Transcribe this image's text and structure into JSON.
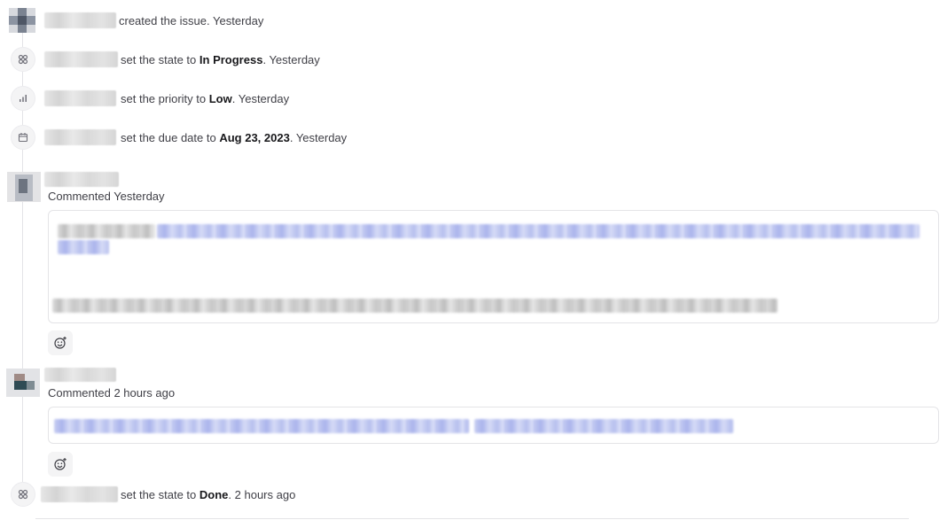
{
  "activity": [
    {
      "icon": "avatar",
      "action": "created the issue.",
      "value": "",
      "time": "Yesterday"
    },
    {
      "icon": "state-icon",
      "action": "set the state to",
      "value": "In Progress",
      "time": "Yesterday"
    },
    {
      "icon": "priority-bars-icon",
      "action": "set the priority to",
      "value": "Low",
      "time": "Yesterday"
    },
    {
      "icon": "calendar-icon",
      "action": "set the due date to",
      "value": "Aug 23, 2023",
      "time": "Yesterday"
    },
    {
      "icon": "state-icon",
      "action": "set the state to",
      "value": "Done",
      "time": "2 hours ago"
    }
  ],
  "comments": [
    {
      "label": "Commented",
      "time": "Yesterday"
    },
    {
      "label": "Commented",
      "time": "2 hours ago"
    }
  ],
  "colors": {
    "border": "#e4e4e7",
    "icon_bg": "#f4f4f5",
    "text": "#3f3f46",
    "strong": "#18181b"
  }
}
